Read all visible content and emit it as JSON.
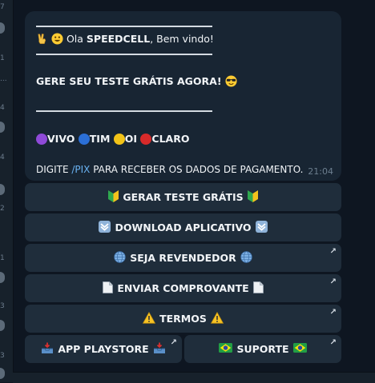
{
  "left_strip": {
    "numbers": [
      "7",
      "1",
      "...",
      "4",
      "4",
      "2",
      "1",
      "3",
      "3"
    ]
  },
  "message": {
    "greeting_prefix": "Ola ",
    "greeting_name": "SPEEDCELL",
    "greeting_suffix": ", Bem vindo!",
    "cta_text": "GERE SEU TESTE GRÁTIS AGORA!",
    "operators": [
      {
        "label": "VIVO",
        "color": "#8f4ad8"
      },
      {
        "label": "TIM",
        "color": "#2b6fd6"
      },
      {
        "label": "OI",
        "color": "#f2c318"
      },
      {
        "label": "CLARO",
        "color": "#d82a2a"
      }
    ],
    "pix_prefix": "DIGITE ",
    "pix_command": "/PIX",
    "pix_suffix": " PARA RECEBER OS DADOS DE PAGAMENTO.",
    "time": "21:04"
  },
  "keyboard": {
    "gerar_teste": "GERAR TESTE GRÁTIS",
    "download_app": "DOWNLOAD APLICATIVO",
    "seja_revendedor": "SEJA REVENDEDOR",
    "enviar_comprovante": "ENVIAR COMPROVANTE",
    "termos": "TERMOS",
    "app_playstore": "APP PLAYSTORE",
    "suporte": "SUPORTE",
    "external_arrow": "↗"
  },
  "icons": {
    "victory": "victory-hand-icon",
    "smiley": "smiley-icon",
    "sunglasses": "sunglasses-face-icon",
    "beginner": "beginner-badge-icon",
    "down_arrow": "down-arrow-button-icon",
    "globe": "globe-meridians-icon",
    "document": "document-icon",
    "warning": "warning-icon",
    "inbox_tray": "inbox-tray-icon",
    "brazil_flag": "brazil-flag-icon"
  }
}
